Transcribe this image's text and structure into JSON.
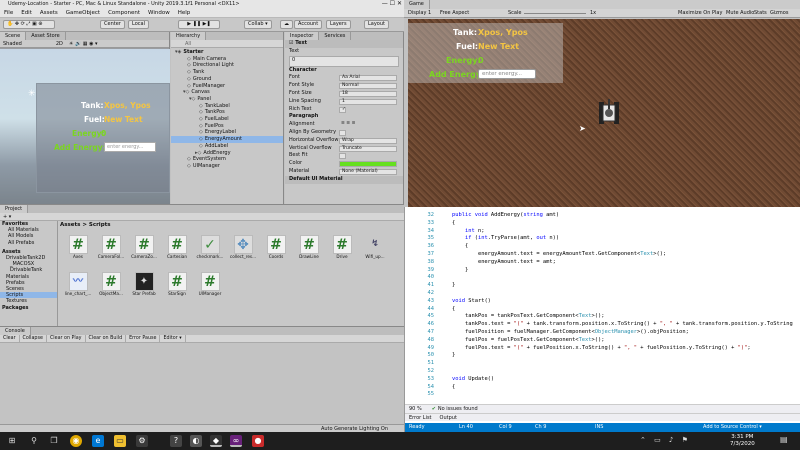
{
  "window": {
    "title": "Udemy-Location - Starter - PC, Mac & Linux Standalone - Unity 2019.3.1f1 Personal <DX11>"
  },
  "menu": [
    "File",
    "Edit",
    "Assets",
    "GameObject",
    "Component",
    "Window",
    "Help"
  ],
  "toolbar": {
    "center": "Center",
    "local": "Local",
    "collab": "Collab ▾",
    "account": "Account",
    "layers": "Layers",
    "layout": "Layout"
  },
  "scene": {
    "tabs": [
      "Scene",
      "Asset Store"
    ],
    "shading": "Shaded",
    "mode_2d": "2D",
    "tank_label": "Tank:",
    "tank_value": "Xpos, Ypos",
    "fuel_label": "Fuel:",
    "fuel_value": "New Text",
    "energy_label": "Energy:",
    "energy_value": "0",
    "add_energy_label": "Add Energy:",
    "add_energy_placeholder": "enter energy..."
  },
  "hierarchy": {
    "tab": "Hierarchy",
    "search": "All",
    "items": [
      "Starter",
      "Main Camera",
      "Directional Light",
      "Tank",
      "Ground",
      "FuelManager",
      "Canvas",
      "Panel",
      "TankLabel",
      "TankPos",
      "FuelLabel",
      "FuelPos",
      "EnergyLabel",
      "EnergyAmount",
      "AddLabel",
      "AddEnergy",
      "EventSystem",
      "UIManager"
    ],
    "selected": "EnergyAmount"
  },
  "inspector": {
    "tabs": [
      "Inspector",
      "Services"
    ],
    "component": "Text",
    "text_label": "Text",
    "text_value": "0",
    "character": "Character",
    "rows": [
      {
        "label": "Font",
        "value": "Aa Arial"
      },
      {
        "label": "Font Style",
        "value": "Normal"
      },
      {
        "label": "Font Size",
        "value": "18"
      },
      {
        "label": "Line Spacing",
        "value": "1"
      },
      {
        "label": "Rich Text",
        "value": "✓"
      }
    ],
    "paragraph": "Paragraph",
    "rows2": [
      {
        "label": "Alignment",
        "value": "≡ ≡ ≡"
      },
      {
        "label": "Align By Geometry",
        "value": ""
      },
      {
        "label": "Horizontal Overflow",
        "value": "Wrap"
      },
      {
        "label": "Vertical Overflow",
        "value": "Truncate"
      },
      {
        "label": "Best Fit",
        "value": ""
      },
      {
        "label": "Color",
        "value": ""
      },
      {
        "label": "Material",
        "value": "None (Material)"
      }
    ],
    "footer": "Default UI Material",
    "color_swatch": "#66e01f"
  },
  "project": {
    "tab": "Project",
    "tree": [
      {
        "label": "Favorites",
        "bold": true
      },
      {
        "label": "All Materials"
      },
      {
        "label": "All Models"
      },
      {
        "label": "All Prefabs"
      },
      {
        "label": "Assets",
        "bold": true
      },
      {
        "label": "DrivableTank2D"
      },
      {
        "label": "_MACOSX"
      },
      {
        "label": "DrivableTank"
      },
      {
        "label": "Materials"
      },
      {
        "label": "Prefabs"
      },
      {
        "label": "Scenes"
      },
      {
        "label": "Scripts",
        "selected": true
      },
      {
        "label": "Textures"
      },
      {
        "label": "Packages",
        "bold": true
      }
    ],
    "breadcrumb": "Assets > Scripts",
    "assets_row1": [
      "Axes",
      "CameraFol...",
      "CameraZo...",
      "Cartesian",
      "checkmark...",
      "collect_res...",
      "Coords",
      "DrawLine",
      "Drive",
      "Wifi_up..."
    ],
    "assets_row2": [
      "line_chart_...",
      "ObjectMa...",
      "Star Prefab",
      "StarSign",
      "UIManager"
    ]
  },
  "console": {
    "tab": "Console",
    "buttons": [
      "Clear",
      "Collapse",
      "Clear on Play",
      "Clear on Build",
      "Error Pause",
      "Editor ▾"
    ],
    "status": "Auto Generate Lighting On"
  },
  "game": {
    "tab": "Game",
    "display": "Display 1",
    "aspect": "Free Aspect",
    "scale_label": "Scale",
    "scale_value": "1x",
    "toggles": [
      "Maximize On Play",
      "Mute Audio",
      "Stats",
      "Gizmos"
    ],
    "tank_label": "Tank:",
    "tank_value": "Xpos, Ypos",
    "fuel_label": "Fuel:",
    "fuel_value": "New Text",
    "energy_label": "Energy:",
    "energy_value": "0",
    "add_energy_label": "Add Energy:",
    "add_energy_placeholder": "enter energy..."
  },
  "editor": {
    "line_numbers": [
      "32",
      "33",
      "34",
      "35",
      "36",
      "37",
      "38",
      "39",
      "40",
      "41",
      "42",
      "43",
      "44",
      "45",
      "46",
      "47",
      "48",
      "49",
      "50",
      "51",
      "52",
      "53",
      "54",
      "55"
    ],
    "zoom": "90 %",
    "issues": "No issues found",
    "bottom_tabs": [
      "Error List",
      "Output"
    ],
    "status_ready": "Ready",
    "ln": "Ln 40",
    "col": "Col 9",
    "ch": "Ch 9",
    "ins": "INS",
    "source_control": "Add to Source Control ▾"
  },
  "taskbar": {
    "time": "3:31 PM",
    "date": "7/3/2020"
  }
}
